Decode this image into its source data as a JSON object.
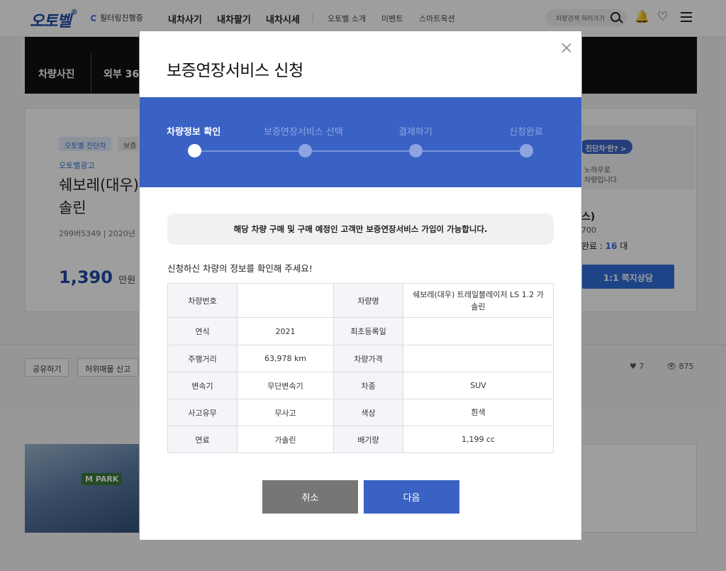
{
  "header": {
    "logo": "오토벨",
    "logo_mark": "®",
    "filter_badge": "필터링진행중",
    "nav_main": [
      "내차사기",
      "내차팔기",
      "내차시세"
    ],
    "nav_sub": [
      "오토벨 소개",
      "이벤트",
      "스마트옥션"
    ],
    "search_placeholder": "차량검색 하러가기"
  },
  "gallery": {
    "tabs": [
      "차량사진",
      "외부 360"
    ]
  },
  "listing": {
    "tags": [
      "오토벨 진단차",
      "보증"
    ],
    "ad_label": "오토벨광고",
    "title_line1": "쉐보레(대우)",
    "title_line2": "솔린",
    "meta": "299버5349 | 2020년",
    "price": "1,390",
    "price_unit": "만원",
    "side_pill": "진단차'란? >",
    "side_text1": "노하우로",
    "side_text2": "차량입니다.",
    "side_title": "스)",
    "side_num": "700",
    "side_count_label": "완료 :",
    "side_count": "16",
    "side_count_unit": "대",
    "consult_button": "1:1 쪽지상담"
  },
  "actions": {
    "share": "공유하기",
    "report": "허위매물 신고",
    "likes": "7",
    "views": "875"
  },
  "banner": {
    "sign": "M PARK"
  },
  "modal": {
    "title": "보증연장서비스 신청",
    "steps": [
      {
        "label": "차량정보 확인",
        "active": true
      },
      {
        "label": "보증연장서비스 선택",
        "active": false
      },
      {
        "label": "결제하기",
        "active": false
      },
      {
        "label": "신청완료",
        "active": false
      }
    ],
    "notice": "해당 차량 구매 및 구매 예정인 고객만 보증연장서비스 가입이 가능합니다.",
    "subtitle": "신청하신 차량의 정보를 확인해 주세요!",
    "table": {
      "rows": [
        {
          "h1": "차량번호",
          "v1": "",
          "h2": "차량명",
          "v2": "쉐보레(대우) 트레일블레이저 LS 1.2 가솔린"
        },
        {
          "h1": "연식",
          "v1": "2021",
          "h2": "최초등록일",
          "v2": ""
        },
        {
          "h1": "주행거리",
          "v1": "63,978 km",
          "h2": "차량가격",
          "v2": ""
        },
        {
          "h1": "변속기",
          "v1": "무단변속기",
          "h2": "차종",
          "v2": "SUV"
        },
        {
          "h1": "사고유무",
          "v1": "무사고",
          "h2": "색상",
          "v2": "흰색"
        },
        {
          "h1": "연료",
          "v1": "가솔린",
          "h2": "배기량",
          "v2": "1,199 cc"
        }
      ]
    },
    "cancel_button": "취소",
    "next_button": "다음"
  }
}
